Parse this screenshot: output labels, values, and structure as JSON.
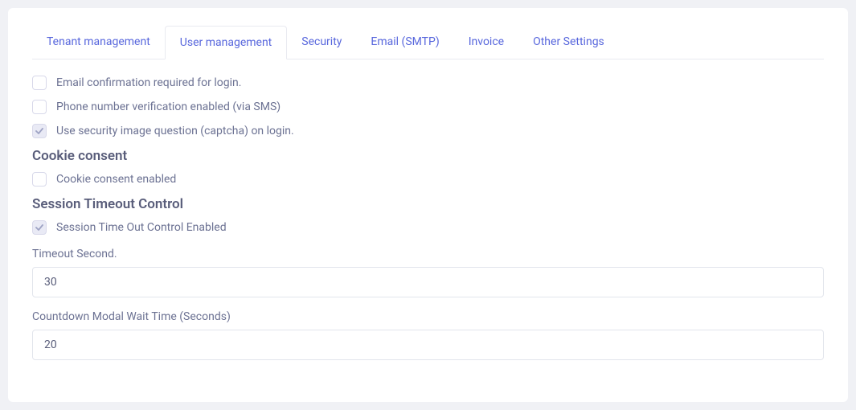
{
  "tabs": [
    {
      "label": "Tenant management",
      "active": false
    },
    {
      "label": "User management",
      "active": true
    },
    {
      "label": "Security",
      "active": false
    },
    {
      "label": "Email (SMTP)",
      "active": false
    },
    {
      "label": "Invoice",
      "active": false
    },
    {
      "label": "Other Settings",
      "active": false
    }
  ],
  "checkboxes": {
    "emailConfirm": {
      "label": "Email confirmation required for login.",
      "checked": false
    },
    "phoneVerify": {
      "label": "Phone number verification enabled (via SMS)",
      "checked": false
    },
    "captcha": {
      "label": "Use security image question (captcha) on login.",
      "checked": true
    },
    "cookieConsent": {
      "label": "Cookie consent enabled",
      "checked": false
    },
    "sessionTimeout": {
      "label": "Session Time Out Control Enabled",
      "checked": true
    }
  },
  "sections": {
    "cookieConsent": "Cookie consent",
    "sessionTimeout": "Session Timeout Control"
  },
  "fields": {
    "timeoutSecond": {
      "label": "Timeout Second.",
      "value": "30"
    },
    "countdownWait": {
      "label": "Countdown Modal Wait Time (Seconds)",
      "value": "20"
    }
  }
}
